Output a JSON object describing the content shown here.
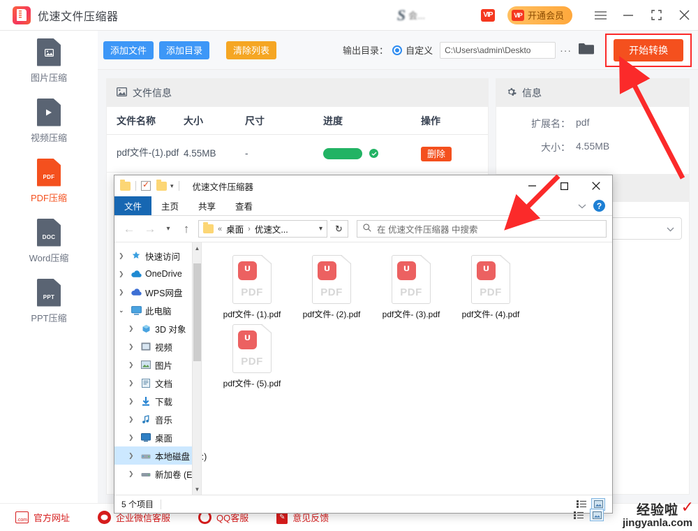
{
  "app": {
    "title": "优速文件压缩器",
    "logo_icon": "compressor-logo-icon",
    "vip_badge": "VIP",
    "vip_button": "开通会员",
    "menu_icon": "hamburger-menu-icon",
    "minimize_icon": "minimize-icon",
    "maximize_icon": "maximize-icon",
    "close_icon": "close-icon",
    "blur_logo_text": "会..."
  },
  "sidebar": {
    "items": [
      {
        "label": "图片压缩",
        "icon": "image-file-icon",
        "tag": "",
        "active": false
      },
      {
        "label": "视频压缩",
        "icon": "video-file-icon",
        "tag": "",
        "active": false
      },
      {
        "label": "PDF压缩",
        "icon": "pdf-file-icon",
        "tag": "PDF",
        "active": true
      },
      {
        "label": "Word压缩",
        "icon": "doc-file-icon",
        "tag": "DOC",
        "active": false
      },
      {
        "label": "PPT压缩",
        "icon": "ppt-file-icon",
        "tag": "PPT",
        "active": false
      }
    ]
  },
  "toolbar": {
    "add_file": "添加文件",
    "add_folder": "添加目录",
    "clear_list": "清除列表",
    "output_label": "输出目录：",
    "radio_custom": "自定义",
    "path_value": "C:\\Users\\admin\\Deskto",
    "more_icon": "ellipsis-icon",
    "folder_icon": "folder-icon",
    "start_button": "开始转换"
  },
  "file_panel": {
    "header": "文件信息",
    "header_icon": "image-panel-icon",
    "columns": [
      "文件名称",
      "大小",
      "尺寸",
      "进度",
      "操作"
    ],
    "rows": [
      {
        "name": "pdf文件-(1).pdf",
        "size": "4.55MB",
        "dimension": "-",
        "progress": 100,
        "status_icon": "check-circle-icon",
        "action": "删除"
      }
    ]
  },
  "info_panel": {
    "header": "信息",
    "header_icon": "gear-icon",
    "rows": [
      {
        "key": "扩展名：",
        "value": "pdf"
      },
      {
        "key": "大小：",
        "value": "4.55MB"
      }
    ],
    "select_icon": "chevron-down-icon"
  },
  "bottom_bar": {
    "items": [
      {
        "label": "官方网址",
        "icon": "website-icon"
      },
      {
        "label": "企业微信客服",
        "icon": "wechat-service-icon"
      },
      {
        "label": "QQ客服",
        "icon": "qq-service-icon"
      },
      {
        "label": "意见反馈",
        "icon": "feedback-icon"
      }
    ]
  },
  "watermark": {
    "top": "经验啦",
    "bottom": "jingyanla.com",
    "check": "✓"
  },
  "explorer": {
    "title": "优速文件压缩器",
    "quick_access_icons": [
      "folder-icon",
      "properties-check-icon",
      "new-folder-icon",
      "dropdown-arrow-icon"
    ],
    "minimize_icon": "minimize-icon",
    "maximize_icon": "maximize-icon",
    "close_icon": "close-icon",
    "ribbon_tabs": [
      "文件",
      "主页",
      "共享",
      "查看"
    ],
    "ribbon_collapse_icon": "chevron-down-icon",
    "help_icon": "help-icon",
    "nav_back_icon": "back-arrow-icon",
    "nav_forward_icon": "forward-arrow-icon",
    "nav_recent_icon": "recent-dropdown-icon",
    "nav_up_icon": "up-arrow-icon",
    "breadcrumb": {
      "prefix": "«",
      "items": [
        "桌面",
        "优速文..."
      ],
      "separator": "›",
      "chevron": "chevron-down-icon"
    },
    "refresh_icon": "refresh-icon",
    "search_placeholder": "在 优速文件压缩器 中搜索",
    "search_icon": "search-icon",
    "nav_tree": [
      {
        "label": "快速访问",
        "icon": "star-pin-icon",
        "level": 0,
        "expanded": false,
        "selected": false
      },
      {
        "label": "OneDrive",
        "icon": "onedrive-cloud-icon",
        "level": 0,
        "expanded": false,
        "selected": false
      },
      {
        "label": "WPS网盘",
        "icon": "wps-cloud-icon",
        "level": 0,
        "expanded": false,
        "selected": false
      },
      {
        "label": "此电脑",
        "icon": "this-pc-icon",
        "level": 0,
        "expanded": true,
        "selected": false
      },
      {
        "label": "3D 对象",
        "icon": "3d-objects-icon",
        "level": 1,
        "expanded": false,
        "selected": false
      },
      {
        "label": "视频",
        "icon": "videos-icon",
        "level": 1,
        "expanded": false,
        "selected": false
      },
      {
        "label": "图片",
        "icon": "pictures-icon",
        "level": 1,
        "expanded": false,
        "selected": false
      },
      {
        "label": "文档",
        "icon": "documents-icon",
        "level": 1,
        "expanded": false,
        "selected": false
      },
      {
        "label": "下载",
        "icon": "downloads-icon",
        "level": 1,
        "expanded": false,
        "selected": false
      },
      {
        "label": "音乐",
        "icon": "music-icon",
        "level": 1,
        "expanded": false,
        "selected": false
      },
      {
        "label": "桌面",
        "icon": "desktop-icon",
        "level": 1,
        "expanded": false,
        "selected": false
      },
      {
        "label": "本地磁盘 (C:)",
        "icon": "local-disk-icon",
        "level": 1,
        "expanded": false,
        "selected": true
      },
      {
        "label": "新加卷 (E:)",
        "icon": "volume-icon",
        "level": 1,
        "expanded": false,
        "selected": false
      }
    ],
    "files": [
      {
        "name": "pdf文件- (1).pdf",
        "icon": "pdf-document-icon",
        "type_label": "PDF"
      },
      {
        "name": "pdf文件- (2).pdf",
        "icon": "pdf-document-icon",
        "type_label": "PDF"
      },
      {
        "name": "pdf文件- (3).pdf",
        "icon": "pdf-document-icon",
        "type_label": "PDF"
      },
      {
        "name": "pdf文件- (4).pdf",
        "icon": "pdf-document-icon",
        "type_label": "PDF"
      },
      {
        "name": "pdf文件- (5).pdf",
        "icon": "pdf-document-icon",
        "type_label": "PDF"
      }
    ],
    "status_text": "5 个项目",
    "view_icons": [
      "details-view-icon",
      "large-icons-view-icon"
    ]
  },
  "annotations": {
    "arrow_color": "#fb2a2a",
    "highlight_box_color": "#fb2a2a"
  }
}
